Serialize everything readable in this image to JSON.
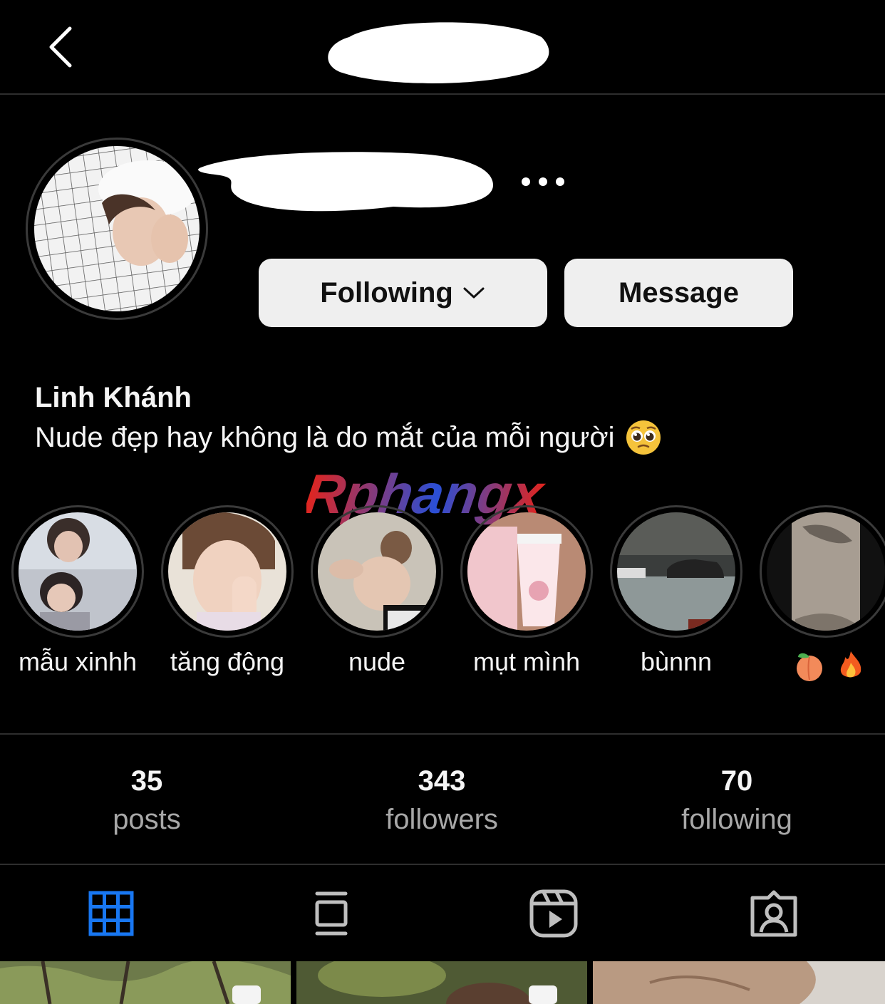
{
  "header": {
    "back_icon": "chevron-left-icon",
    "title": ""
  },
  "profile": {
    "username": "",
    "more_icon": "ellipsis-horizontal-icon",
    "display_name": "Linh Khánh",
    "bio": "Nude đẹp hay không là do mắt của mỗi người",
    "bio_emoji": "pleading-face-emoji"
  },
  "actions": {
    "following_label": "Following",
    "following_icon": "chevron-down-icon",
    "message_label": "Message"
  },
  "watermark": "Rphangx",
  "highlights": [
    {
      "label": "mẫu xinhh"
    },
    {
      "label": "tăng động"
    },
    {
      "label": "nude"
    },
    {
      "label": "mụt mình"
    },
    {
      "label": "bùnnn"
    },
    {
      "label": "",
      "emojis": [
        "peach-emoji",
        "fire-emoji"
      ]
    }
  ],
  "stats": [
    {
      "value": "35",
      "label": "posts"
    },
    {
      "value": "343",
      "label": "followers"
    },
    {
      "value": "70",
      "label": "following"
    }
  ],
  "tabs": [
    {
      "icon": "grid-icon",
      "active": true
    },
    {
      "icon": "guides-icon",
      "active": false
    },
    {
      "icon": "reels-icon",
      "active": false
    },
    {
      "icon": "tagged-icon",
      "active": false
    }
  ],
  "colors": {
    "background": "#000000",
    "button": "#efefef",
    "active_tab": "#1877f2",
    "muted_text": "#a8a8a8"
  }
}
